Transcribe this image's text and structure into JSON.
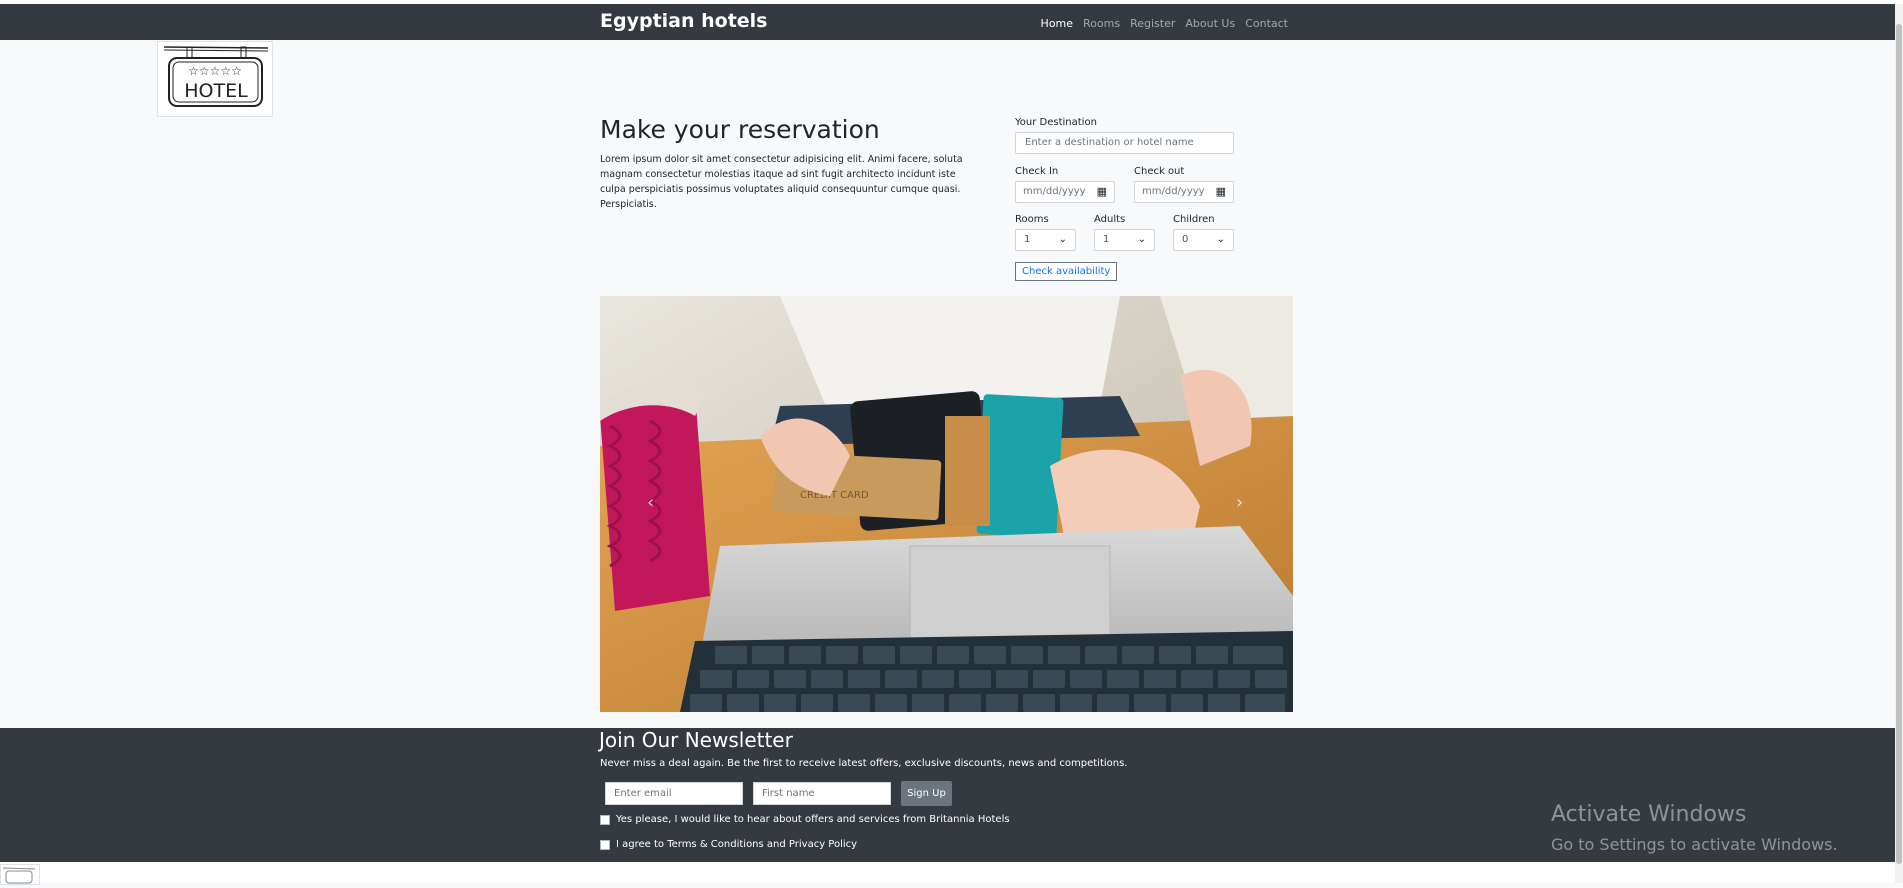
{
  "navbar": {
    "brand": "Egyptian hotels",
    "items": [
      {
        "label": "Home",
        "active": true
      },
      {
        "label": "Rooms",
        "active": false
      },
      {
        "label": "Register",
        "active": false
      },
      {
        "label": "About Us",
        "active": false
      },
      {
        "label": "Contact",
        "active": false
      }
    ]
  },
  "logo": {
    "text": "HOTEL",
    "icon": "hotel-sign-icon"
  },
  "reservation": {
    "title": "Make your reservation",
    "description": "Lorem ipsum dolor sit amet consectetur adipisicing elit. Animi facere, soluta magnam consectetur molestias itaque ad sint fugit architecto incidunt iste culpa perspiciatis possimus voluptates aliquid consequuntur cumque quasi. Perspiciatis.",
    "destination_label": "Your Destination",
    "destination_placeholder": "Enter a destination or hotel name",
    "checkin_label": "Check In",
    "checkout_label": "Check out",
    "date_placeholder": "mm/dd/yyyy",
    "rooms_label": "Rooms",
    "adults_label": "Adults",
    "children_label": "Children",
    "rooms_value": "1",
    "adults_value": "1",
    "children_value": "0",
    "button_label": "Check availability"
  },
  "carousel": {
    "prev_icon": "chevron-left-icon",
    "next_icon": "chevron-right-icon",
    "card_text": "CREDIT CARD"
  },
  "newsletter": {
    "title": "Join Our Newsletter",
    "text": "Never miss a deal again. Be the first to receive latest offers, exclusive discounts, news and competitions.",
    "email_placeholder": "Enter email",
    "name_placeholder": "First name",
    "button_label": "Sign Up",
    "opt_in_label": "Yes please, I would like to hear about offers and services from Britannia Hotels",
    "terms_label": "I agree to Terms & Conditions and Privacy Policy"
  },
  "watermark": {
    "line1": "Activate Windows",
    "line2": "Go to Settings to activate Windows."
  },
  "colors": {
    "navbar": "#343a40",
    "background": "#f8f9fa",
    "accent": "#0d6efd",
    "button": "#6c757d"
  }
}
